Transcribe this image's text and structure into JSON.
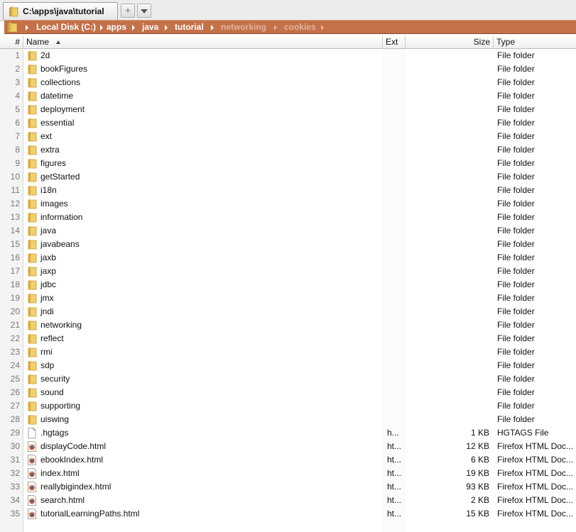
{
  "tab": {
    "title": "C:\\apps\\java\\tutorial",
    "new_tab_glyph": "+",
    "icon": "folder-icon"
  },
  "breadcrumb": {
    "items": [
      {
        "label": "Local Disk (C:)",
        "active": true
      },
      {
        "label": "apps",
        "active": true
      },
      {
        "label": "java",
        "active": true
      },
      {
        "label": "tutorial",
        "active": true
      },
      {
        "label": "networking",
        "active": false
      },
      {
        "label": "cookies",
        "active": false
      }
    ]
  },
  "columns": {
    "num": "#",
    "name": "Name",
    "ext": "Ext",
    "size": "Size",
    "type": "Type"
  },
  "colors": {
    "breadcrumb_bg": "#c4714a",
    "folder_icon": "#e8c35a"
  },
  "rows": [
    {
      "num": "1",
      "name": "2d",
      "ext": "",
      "size": "",
      "type": "File folder",
      "icon": "folder-icon"
    },
    {
      "num": "2",
      "name": "bookFigures",
      "ext": "",
      "size": "",
      "type": "File folder",
      "icon": "folder-icon"
    },
    {
      "num": "3",
      "name": "collections",
      "ext": "",
      "size": "",
      "type": "File folder",
      "icon": "folder-icon"
    },
    {
      "num": "4",
      "name": "datetime",
      "ext": "",
      "size": "",
      "type": "File folder",
      "icon": "folder-icon"
    },
    {
      "num": "5",
      "name": "deployment",
      "ext": "",
      "size": "",
      "type": "File folder",
      "icon": "folder-icon"
    },
    {
      "num": "6",
      "name": "essential",
      "ext": "",
      "size": "",
      "type": "File folder",
      "icon": "folder-icon"
    },
    {
      "num": "7",
      "name": "ext",
      "ext": "",
      "size": "",
      "type": "File folder",
      "icon": "folder-icon"
    },
    {
      "num": "8",
      "name": "extra",
      "ext": "",
      "size": "",
      "type": "File folder",
      "icon": "folder-icon"
    },
    {
      "num": "9",
      "name": "figures",
      "ext": "",
      "size": "",
      "type": "File folder",
      "icon": "folder-icon"
    },
    {
      "num": "10",
      "name": "getStarted",
      "ext": "",
      "size": "",
      "type": "File folder",
      "icon": "folder-icon"
    },
    {
      "num": "11",
      "name": "i18n",
      "ext": "",
      "size": "",
      "type": "File folder",
      "icon": "folder-icon"
    },
    {
      "num": "12",
      "name": "images",
      "ext": "",
      "size": "",
      "type": "File folder",
      "icon": "folder-icon"
    },
    {
      "num": "13",
      "name": "information",
      "ext": "",
      "size": "",
      "type": "File folder",
      "icon": "folder-icon"
    },
    {
      "num": "14",
      "name": "java",
      "ext": "",
      "size": "",
      "type": "File folder",
      "icon": "folder-icon"
    },
    {
      "num": "15",
      "name": "javabeans",
      "ext": "",
      "size": "",
      "type": "File folder",
      "icon": "folder-icon"
    },
    {
      "num": "16",
      "name": "jaxb",
      "ext": "",
      "size": "",
      "type": "File folder",
      "icon": "folder-icon"
    },
    {
      "num": "17",
      "name": "jaxp",
      "ext": "",
      "size": "",
      "type": "File folder",
      "icon": "folder-icon"
    },
    {
      "num": "18",
      "name": "jdbc",
      "ext": "",
      "size": "",
      "type": "File folder",
      "icon": "folder-icon"
    },
    {
      "num": "19",
      "name": "jmx",
      "ext": "",
      "size": "",
      "type": "File folder",
      "icon": "folder-icon"
    },
    {
      "num": "20",
      "name": "jndi",
      "ext": "",
      "size": "",
      "type": "File folder",
      "icon": "folder-icon"
    },
    {
      "num": "21",
      "name": "networking",
      "ext": "",
      "size": "",
      "type": "File folder",
      "icon": "folder-icon"
    },
    {
      "num": "22",
      "name": "reflect",
      "ext": "",
      "size": "",
      "type": "File folder",
      "icon": "folder-icon"
    },
    {
      "num": "23",
      "name": "rmi",
      "ext": "",
      "size": "",
      "type": "File folder",
      "icon": "folder-icon"
    },
    {
      "num": "24",
      "name": "sdp",
      "ext": "",
      "size": "",
      "type": "File folder",
      "icon": "folder-icon"
    },
    {
      "num": "25",
      "name": "security",
      "ext": "",
      "size": "",
      "type": "File folder",
      "icon": "folder-icon"
    },
    {
      "num": "26",
      "name": "sound",
      "ext": "",
      "size": "",
      "type": "File folder",
      "icon": "folder-icon"
    },
    {
      "num": "27",
      "name": "supporting",
      "ext": "",
      "size": "",
      "type": "File folder",
      "icon": "folder-icon"
    },
    {
      "num": "28",
      "name": "uiswing",
      "ext": "",
      "size": "",
      "type": "File folder",
      "icon": "folder-icon"
    },
    {
      "num": "29",
      "name": ".hgtags",
      "ext": "h...",
      "size": "1 KB",
      "type": "HGTAGS File",
      "icon": "file-icon"
    },
    {
      "num": "30",
      "name": "displayCode.html",
      "ext": "ht...",
      "size": "12 KB",
      "type": "Firefox HTML Doc...",
      "icon": "firefox-html-icon"
    },
    {
      "num": "31",
      "name": "ebookIndex.html",
      "ext": "ht...",
      "size": "6 KB",
      "type": "Firefox HTML Doc...",
      "icon": "firefox-html-icon"
    },
    {
      "num": "32",
      "name": "index.html",
      "ext": "ht...",
      "size": "19 KB",
      "type": "Firefox HTML Doc...",
      "icon": "firefox-html-icon"
    },
    {
      "num": "33",
      "name": "reallybigindex.html",
      "ext": "ht...",
      "size": "93 KB",
      "type": "Firefox HTML Doc...",
      "icon": "firefox-html-icon"
    },
    {
      "num": "34",
      "name": "search.html",
      "ext": "ht...",
      "size": "2 KB",
      "type": "Firefox HTML Doc...",
      "icon": "firefox-html-icon"
    },
    {
      "num": "35",
      "name": "tutorialLearningPaths.html",
      "ext": "ht...",
      "size": "15 KB",
      "type": "Firefox HTML Doc...",
      "icon": "firefox-html-icon"
    }
  ]
}
